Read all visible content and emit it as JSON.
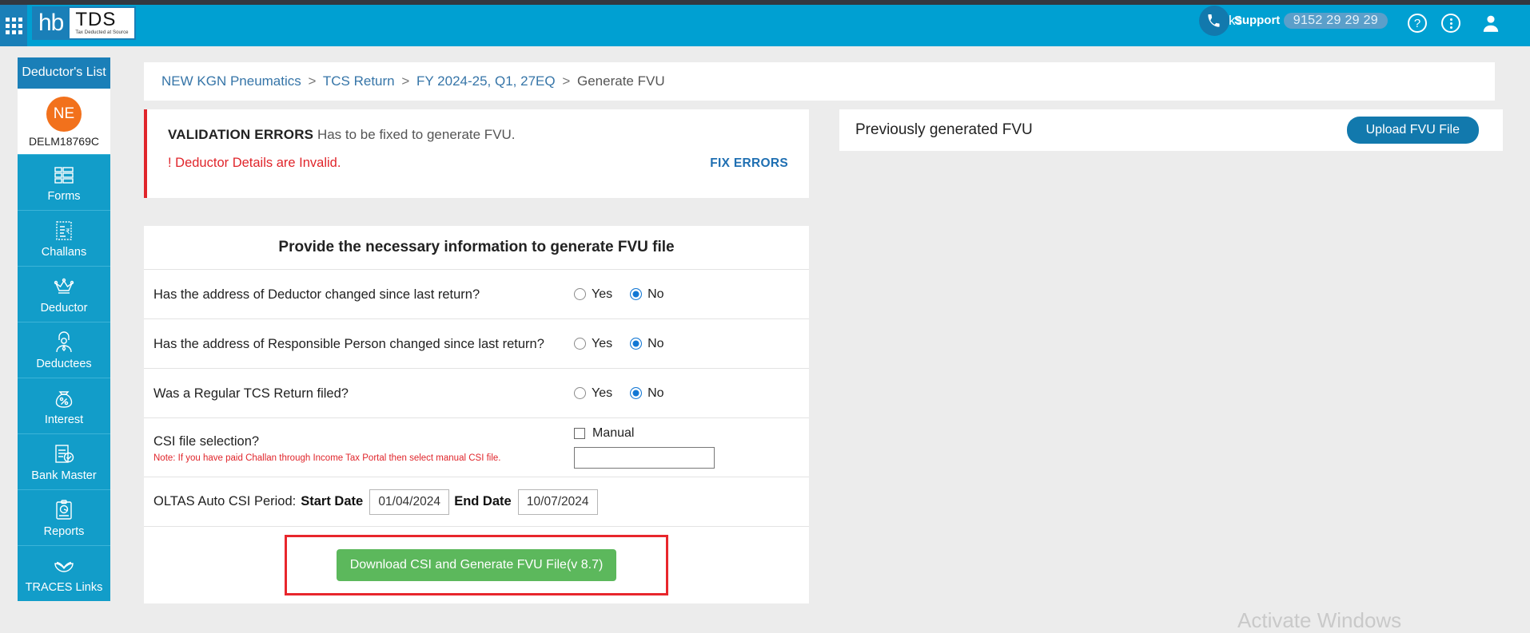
{
  "header": {
    "brand": {
      "hb": "hb",
      "tds": "TDS",
      "tds_sub": "Tax Deducted at Source"
    },
    "tasks_label": "Tasks",
    "support_title": "Support",
    "support_phone": "9152 29 29 29",
    "help_glyph": "?",
    "icons": {
      "app_grid": "app-grid-icon",
      "phone": "phone-icon",
      "help": "help-circle-icon",
      "info": "more-options-icon",
      "user": "user-avatar-icon"
    },
    "colors": {
      "bar": "#00a0d2",
      "logo_block": "#1a7fb8",
      "strip": "#333840"
    }
  },
  "sidebar": {
    "title": "Deductor's List",
    "deductor": {
      "initials": "NE",
      "tan": "DELM18769C",
      "avatar_color": "#f2711c"
    },
    "items": [
      {
        "label": "Forms",
        "icon": "forms-icon"
      },
      {
        "label": "Challans",
        "icon": "challan-receipt-icon"
      },
      {
        "label": "Deductor",
        "icon": "crown-icon"
      },
      {
        "label": "Deductees",
        "icon": "person-tie-icon"
      },
      {
        "label": "Interest",
        "icon": "money-bag-percent-icon"
      },
      {
        "label": "Bank Master",
        "icon": "bank-document-check-icon"
      },
      {
        "label": "Reports",
        "icon": "clipboard-chart-icon"
      },
      {
        "label": "TRACES Links",
        "icon": "traces-leaf-icon"
      }
    ]
  },
  "breadcrumb": {
    "items": [
      "NEW KGN Pneumatics",
      "TCS Return",
      "FY 2024-25, Q1, 27EQ"
    ],
    "current": "Generate FVU",
    "separator": ">"
  },
  "validation": {
    "title": "VALIDATION ERRORS",
    "subtitle": "Has to be fixed to generate FVU.",
    "error_item": "! Deductor Details are Invalid.",
    "fix_link": "FIX ERRORS",
    "accent_color": "#e0252b"
  },
  "form": {
    "title": "Provide the necessary information to generate FVU file",
    "rows": [
      {
        "label": "Has the address of Deductor changed since last return?",
        "type": "radio",
        "options": [
          "Yes",
          "No"
        ],
        "selected": "No"
      },
      {
        "label": "Has the address of Responsible Person changed since last return?",
        "type": "radio",
        "options": [
          "Yes",
          "No"
        ],
        "selected": "No"
      },
      {
        "label": "Was a Regular TCS Return filed?",
        "type": "radio",
        "options": [
          "Yes",
          "No"
        ],
        "selected": "No"
      }
    ],
    "csi": {
      "label": "CSI file selection?",
      "note": "Note: If you have paid Challan through Income Tax Portal then select manual CSI file.",
      "checkbox_label": "Manual",
      "checked": false,
      "input_value": "",
      "input_placeholder": ""
    },
    "oltas": {
      "label": "OLTAS Auto CSI Period:",
      "start_label": "Start Date",
      "start_value": "01/04/2024",
      "end_label": "End Date",
      "end_value": "10/07/2024"
    },
    "generate_button": "Download CSI and Generate FVU File(v 8.7)",
    "highlight_color": "#e8262c",
    "button_color": "#5cb85c"
  },
  "previous_fvu": {
    "title": "Previously generated FVU",
    "upload_button": "Upload FVU File",
    "button_color": "#1279ad"
  },
  "watermark": "Activate Windows"
}
